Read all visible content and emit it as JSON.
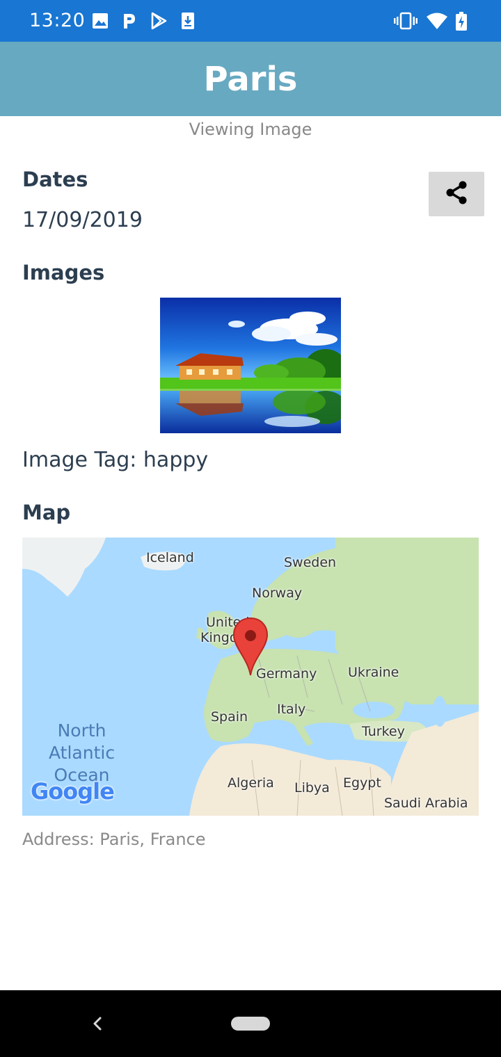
{
  "status_bar": {
    "time": "13:20",
    "left_icons": [
      "image-icon",
      "parking-p-icon",
      "play-store-icon",
      "download-icon"
    ],
    "right_icons": [
      "vibrate-icon",
      "wifi-icon",
      "battery-charging-icon"
    ],
    "background": "#1976d2"
  },
  "app_bar": {
    "title": "Paris",
    "background": "#67a9c1"
  },
  "subtitle": "Viewing Image",
  "dates": {
    "heading": "Dates",
    "value": "17/09/2019",
    "share_icon": "share-icon"
  },
  "images": {
    "heading": "Images",
    "tag_text": "Image Tag: happy"
  },
  "map": {
    "heading": "Map",
    "labels": {
      "iceland": "Iceland",
      "sweden": "Sweden",
      "norway": "Norway",
      "uk_line1": "United",
      "uk_line2": "Kingd",
      "germany": "Germany",
      "ukraine": "Ukraine",
      "spain": "Spain",
      "italy": "Italy",
      "turkey": "Turkey",
      "algeria": "Algeria",
      "libya": "Libya",
      "egypt": "Egypt",
      "saudi_arabia": "Saudi Arabia"
    },
    "ocean": {
      "line1": "North",
      "line2": "Atlantic",
      "line3": "Ocean"
    },
    "logo": "Google",
    "marker_icon": "map-pin-icon",
    "colors": {
      "water": "#aadaff",
      "land": "#c8e2b0",
      "desert": "#f3ead8",
      "marker": "#e9423a"
    }
  },
  "address": "Address: Paris, France",
  "nav_bar": {
    "back_icon": "back-chevron-icon",
    "home_icon": "home-pill-icon"
  }
}
